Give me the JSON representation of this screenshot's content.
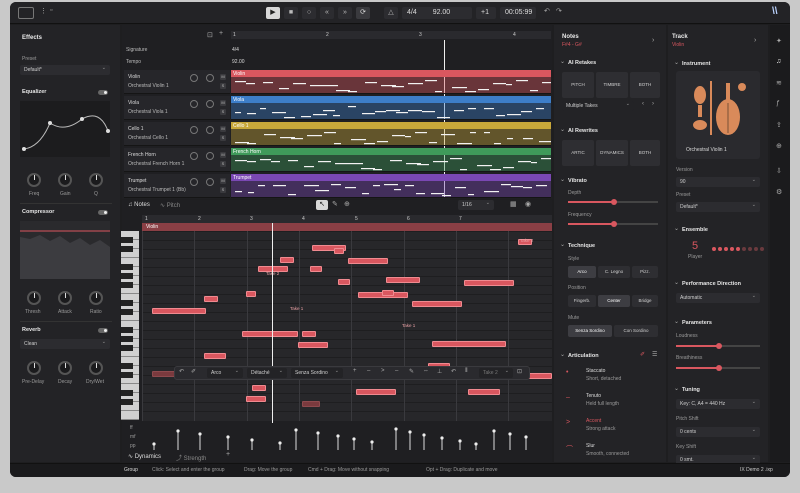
{
  "transport": {
    "time_sig": "4/4",
    "tempo": "92.00",
    "marker": "+1",
    "time": "00:05:99"
  },
  "effects": {
    "title": "Effects",
    "preset_label": "Preset",
    "preset_value": "Default*",
    "equalizer": {
      "title": "Equalizer",
      "knobs": [
        "Freq",
        "Gain",
        "Q"
      ]
    },
    "compressor": {
      "title": "Compressor",
      "knobs": [
        "Thresh",
        "Attack",
        "Ratio"
      ]
    },
    "reverb": {
      "title": "Reverb",
      "type": "Clean",
      "knobs": [
        "Pre-Delay",
        "Decay",
        "Dry/Wet"
      ]
    }
  },
  "arrange": {
    "signature_label": "Signature",
    "signature_value": "4/4",
    "tempo_label": "Tempo",
    "tempo_value": "92.00",
    "ruler": [
      "1",
      "2",
      "3",
      "4"
    ],
    "tracks": [
      {
        "name": "Violin",
        "instrument": "Orchestral Violin 1",
        "color": "#d9575f",
        "lane": "Violin"
      },
      {
        "name": "Viola",
        "instrument": "Orchestral Viola 1",
        "color": "#3d7ec9",
        "lane": "Viola"
      },
      {
        "name": "Cello 1",
        "instrument": "Orchestral Cello 1",
        "color": "#c9a83a",
        "lane": "Cello 1"
      },
      {
        "name": "French Horn",
        "instrument": "Orchestral French Horn 1",
        "color": "#3f9a5a",
        "lane": "French Horn"
      },
      {
        "name": "Trumpet",
        "instrument": "Orchestral Trumpet 1 (Bb)",
        "color": "#7a48b3",
        "lane": "Trumpet"
      }
    ]
  },
  "editor": {
    "tabs": [
      "Notes",
      "Pitch"
    ],
    "quantize": "1/16",
    "ruler": [
      "1",
      "2",
      "3",
      "4",
      "5",
      "6",
      "7"
    ],
    "clip_label": "Violin",
    "note_labels": [
      "Take 2",
      "Take 1",
      "Take 1",
      "Take 2"
    ],
    "toolbar": {
      "artic": "Arco",
      "dyn": "Détaché",
      "mute": "Senza Sordino",
      "take": "Take 2"
    },
    "bottom_tabs": [
      "Dynamics",
      "Strength"
    ]
  },
  "notes_panel": {
    "title": "Notes",
    "subtitle": "F#4 - G#",
    "retakes": {
      "title": "AI Retakes",
      "buttons": [
        "PITCH",
        "TIMBRE",
        "BOTH"
      ],
      "multi": "Multiple Takes"
    },
    "rewrites": {
      "title": "AI Rewrites",
      "buttons": [
        "ARTIC",
        "DYNAMICS",
        "BOTH"
      ]
    },
    "vibrato": {
      "title": "Vibrato",
      "depth": "Depth",
      "frequency": "Frequency"
    },
    "technique": {
      "title": "Technique",
      "style_label": "Style",
      "style": [
        "Arco",
        "C. Legno",
        "Pizz."
      ],
      "position_label": "Position",
      "position": [
        "Fingerb.",
        "Center",
        "Bridge"
      ],
      "mute_label": "Mute",
      "mute": [
        "Senza Sordino",
        "Con Sordino"
      ]
    },
    "articulation": {
      "title": "Articulation",
      "items": [
        {
          "name": "Staccato",
          "desc": "Short, detached"
        },
        {
          "name": "Tenuto",
          "desc": "Held full length"
        },
        {
          "name": "Accent",
          "desc": "Strong attack"
        },
        {
          "name": "Slur",
          "desc": "Smooth, connected"
        }
      ]
    }
  },
  "track_panel": {
    "title": "Track",
    "subtitle": "Violin",
    "instrument_title": "Instrument",
    "instrument_name": "Orchestral Violin 1",
    "version_label": "Version",
    "version": "90",
    "preset_label": "Preset",
    "preset": "Default*",
    "ensemble_title": "Ensemble",
    "players": "5",
    "players_label": "Player",
    "perf_title": "Performance Direction",
    "perf": "Automatic",
    "params_title": "Parameters",
    "loudness": "Loudness",
    "breathiness": "Breathiness",
    "tuning_title": "Tuning",
    "tuning": "Key: C, A4 = 440 Hz",
    "pitch_shift_label": "Pitch Shift",
    "pitch_shift": "0 cents",
    "key_shift_label": "Key Shift",
    "key_shift": "0 smt."
  },
  "status": {
    "group": "Group",
    "hints": [
      "Click: Select and enter the group",
      "Drag: Move the group",
      "Cmd + Drag: Move without snapping",
      "Opt + Drag: Duplicate and move"
    ],
    "project": "IX Demo 2 .ixp"
  }
}
